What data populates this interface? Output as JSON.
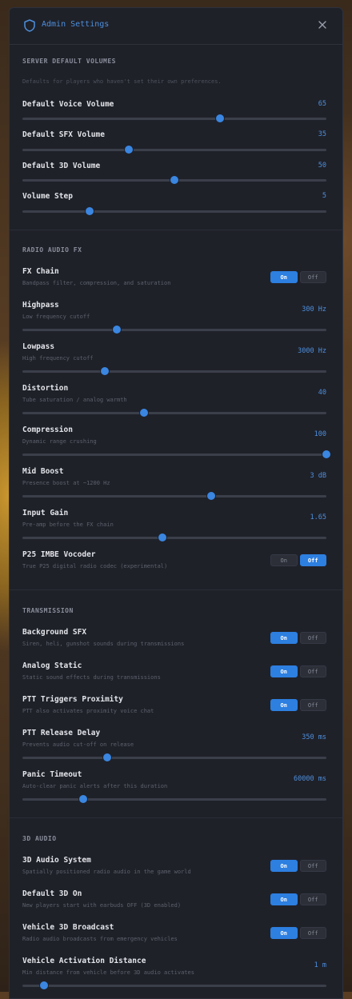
{
  "header": {
    "title": "Admin Settings",
    "shield_icon": "shield-icon",
    "close_icon": "close-icon"
  },
  "server_volumes": {
    "title": "SERVER DEFAULT VOLUMES",
    "description": "Defaults for players who haven't set their own preferences.",
    "sliders": [
      {
        "label": "Default Voice Volume",
        "value": "65",
        "level": 0.65
      },
      {
        "label": "Default SFX Volume",
        "value": "35",
        "level": 0.35
      },
      {
        "label": "Default 3D Volume",
        "value": "50",
        "level": 0.5
      },
      {
        "label": "Volume Step",
        "value": "5",
        "level": 0.22
      }
    ]
  },
  "radio_fx": {
    "title": "RADIO AUDIO FX",
    "fx_chain": {
      "label": "FX Chain",
      "sub": "Bandpass filter, compression, and saturation",
      "on": "On",
      "off": "Off",
      "state": "on"
    },
    "sliders": [
      {
        "label": "Highpass",
        "sub": "Low frequency cutoff",
        "value": "300 Hz",
        "level": 0.31
      },
      {
        "label": "Lowpass",
        "sub": "High frequency cutoff",
        "value": "3000 Hz",
        "level": 0.27
      },
      {
        "label": "Distortion",
        "sub": "Tube saturation / analog warmth",
        "value": "40",
        "level": 0.4
      },
      {
        "label": "Compression",
        "sub": "Dynamic range crushing",
        "value": "100",
        "level": 1.0
      },
      {
        "label": "Mid Boost",
        "sub": "Presence boost at ~1200 Hz",
        "value": "3 dB",
        "level": 0.62
      },
      {
        "label": "Input Gain",
        "sub": "Pre-amp before the FX chain",
        "value": "1.65",
        "level": 0.46
      }
    ],
    "vocoder": {
      "label": "P25 IMBE Vocoder",
      "sub": "True P25 digital radio codec (experimental)",
      "on": "On",
      "off": "Off",
      "state": "off"
    }
  },
  "transmission": {
    "title": "TRANSMISSION",
    "toggles": [
      {
        "label": "Background SFX",
        "sub": "Siren, heli, gunshot sounds during transmissions",
        "on": "On",
        "off": "Off",
        "state": "on"
      },
      {
        "label": "Analog Static",
        "sub": "Static sound effects during transmissions",
        "on": "On",
        "off": "Off",
        "state": "on"
      },
      {
        "label": "PTT Triggers Proximity",
        "sub": "PTT also activates proximity voice chat",
        "on": "On",
        "off": "Off",
        "state": "on"
      }
    ],
    "sliders": [
      {
        "label": "PTT Release Delay",
        "sub": "Prevents audio cut-off on release",
        "value": "350 ms",
        "level": 0.28
      },
      {
        "label": "Panic Timeout",
        "sub": "Auto-clear panic alerts after this duration",
        "value": "60000 ms",
        "level": 0.2
      }
    ]
  },
  "audio3d": {
    "title": "3D AUDIO",
    "toggles": [
      {
        "label": "3D Audio System",
        "sub": "Spatially positioned radio audio in the game world",
        "on": "On",
        "off": "Off",
        "state": "on"
      },
      {
        "label": "Default 3D On",
        "sub": "New players start with earbuds OFF (3D enabled)",
        "on": "On",
        "off": "Off",
        "state": "on"
      },
      {
        "label": "Vehicle 3D Broadcast",
        "sub": "Radio audio broadcasts from emergency vehicles",
        "on": "On",
        "off": "Off",
        "state": "on"
      }
    ],
    "sliders": [
      {
        "label": "Vehicle Activation Distance",
        "sub": "Min distance from vehicle before 3D audio activates",
        "value": "1 m",
        "level": 0.07
      }
    ]
  }
}
